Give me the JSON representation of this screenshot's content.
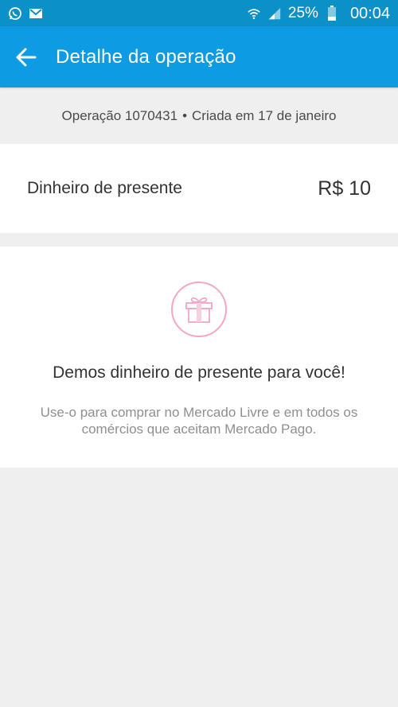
{
  "status_bar": {
    "battery_percent": "25%",
    "time": "00:04",
    "icons": [
      "whatsapp-icon",
      "gmail-icon",
      "wifi-icon",
      "signal-icon",
      "battery-icon"
    ]
  },
  "app_bar": {
    "title": "Detalhe da operação",
    "back_icon": "arrow-back-icon"
  },
  "operation": {
    "label": "Operação 1070431",
    "separator": "•",
    "created": "Criada em 17 de janeiro"
  },
  "amount": {
    "label": "Dinheiro de presente",
    "value": "R$ 10"
  },
  "gift": {
    "icon": "gift-icon",
    "title": "Demos dinheiro de presente para você!",
    "description": "Use-o para comprar no Mercado Livre e em todos os comércios que aceitam Mercado Pago."
  },
  "colors": {
    "status_bar": "#0b90c8",
    "app_bar": "#0d9be3",
    "background": "#efefef",
    "gift_accent": "#f3a6c6"
  }
}
